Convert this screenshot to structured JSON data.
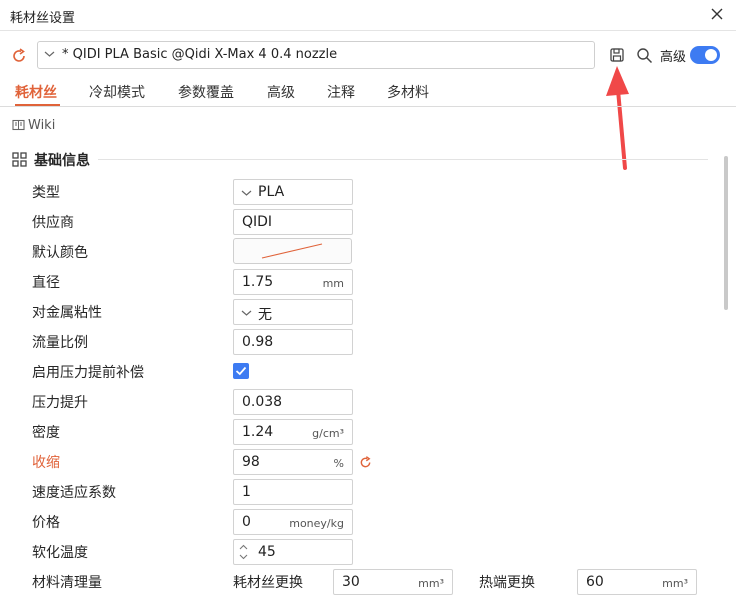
{
  "window": {
    "title": "耗材丝设置"
  },
  "toolbar": {
    "preset_name": "* QIDI PLA Basic @Qidi X-Max 4 0.4 nozzle",
    "advanced_label": "高级",
    "advanced_on": true,
    "accent": "#3d7bf2"
  },
  "tabs": [
    {
      "label": "耗材丝",
      "active": true
    },
    {
      "label": "冷却模式"
    },
    {
      "label": "参数覆盖"
    },
    {
      "label": "高级"
    },
    {
      "label": "注释"
    },
    {
      "label": "多材料"
    }
  ],
  "wiki": {
    "label": "Wiki"
  },
  "section": {
    "title": "基础信息"
  },
  "fields": {
    "type": {
      "label": "类型",
      "value": "PLA"
    },
    "vendor": {
      "label": "供应商",
      "value": "QIDI"
    },
    "color": {
      "label": "默认颜色"
    },
    "diameter": {
      "label": "直径",
      "value": "1.75",
      "unit": "mm"
    },
    "metal_adhesion": {
      "label": "对金属粘性",
      "value": "无"
    },
    "flow_ratio": {
      "label": "流量比例",
      "value": "0.98"
    },
    "pressure_advance_enable": {
      "label": "启用压力提前补偿",
      "checked": true
    },
    "pressure_advance": {
      "label": "压力提升",
      "value": "0.038"
    },
    "density": {
      "label": "密度",
      "value": "1.24",
      "unit": "g/cm³"
    },
    "shrinkage": {
      "label": "收缩",
      "value": "98",
      "unit": "%",
      "modified_color": "#e0633a"
    },
    "velocity_adaptation": {
      "label": "速度适应系数",
      "value": "1"
    },
    "price": {
      "label": "价格",
      "value": "0",
      "unit": "money/kg"
    },
    "softening_temp": {
      "label": "软化温度",
      "value": "45"
    },
    "purge": {
      "label": "材料清理量",
      "filament_change_label": "耗材丝更换",
      "filament_change_value": "30",
      "hotend_change_label": "热端更换",
      "hotend_change_value": "60",
      "unit": "mm³"
    }
  }
}
